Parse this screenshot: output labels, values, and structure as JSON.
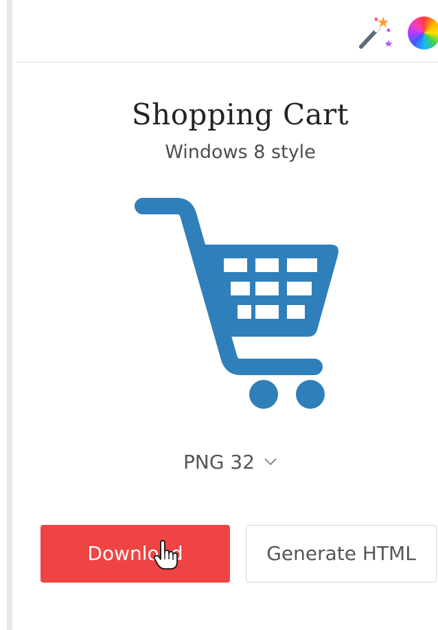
{
  "toolbar": {
    "magic_icon": "magic-wand-icon",
    "color_icon": "color-wheel-icon"
  },
  "icon_detail": {
    "title": "Shopping Cart",
    "subtitle": "Windows 8 style",
    "icon_name": "shopping-cart-icon",
    "icon_color": "#2f7fba"
  },
  "format": {
    "selected": "PNG 32"
  },
  "actions": {
    "download_label": "Download",
    "download_color": "#ef4444",
    "generate_html_label": "Generate HTML"
  }
}
